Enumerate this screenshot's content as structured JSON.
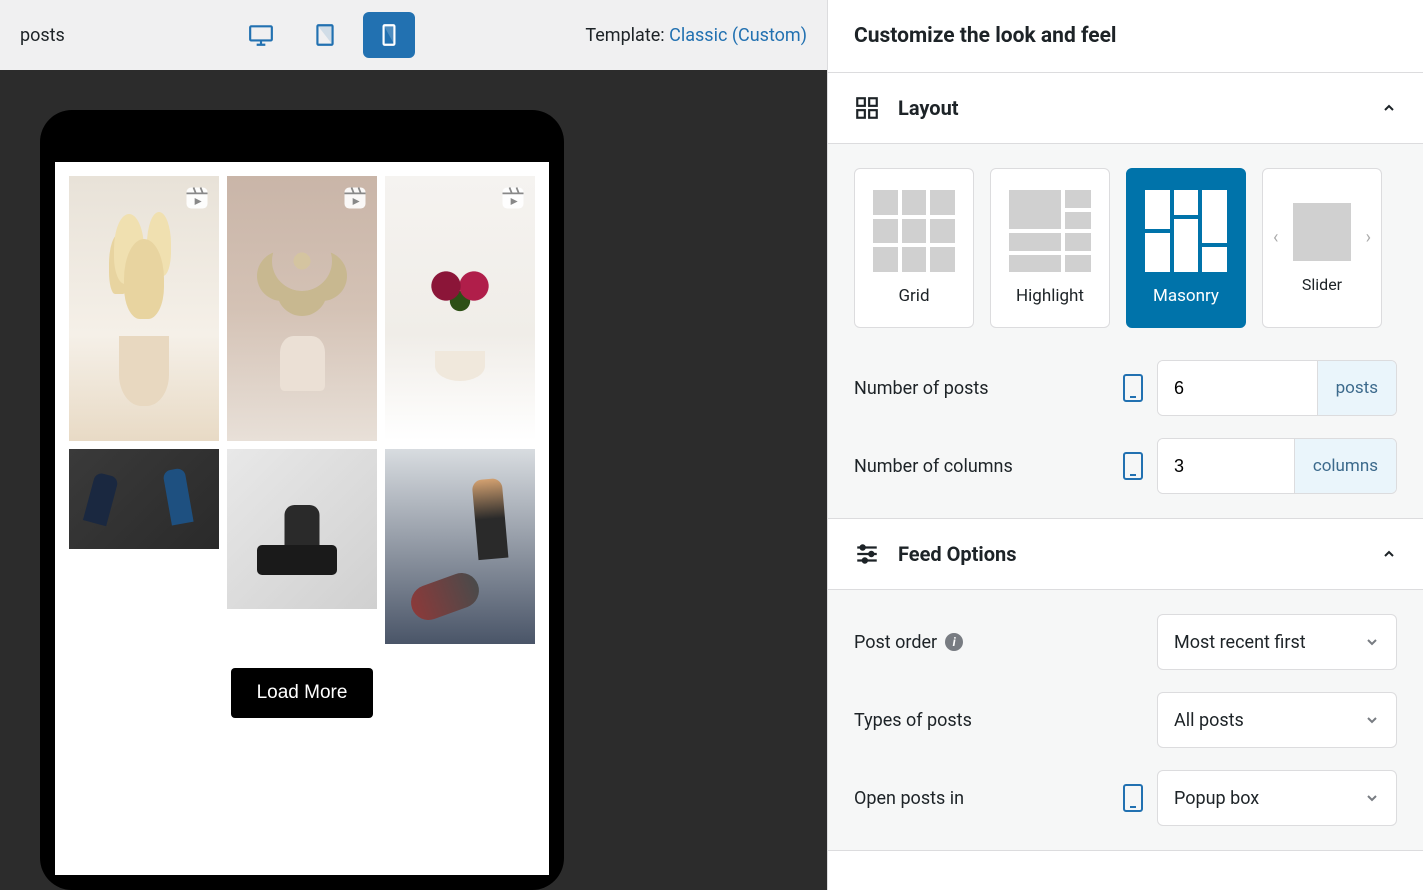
{
  "topbar": {
    "left_text": "posts",
    "devices": [
      "desktop",
      "tablet",
      "mobile"
    ],
    "active_device": "mobile",
    "template_label": "Template:",
    "template_value": "Classic (Custom)"
  },
  "preview": {
    "load_more_label": "Load More",
    "posts": [
      {
        "id": "plant1",
        "is_reel": true
      },
      {
        "id": "plant2",
        "is_reel": true
      },
      {
        "id": "plant3",
        "is_reel": true
      },
      {
        "id": "gym1",
        "is_reel": false
      },
      {
        "id": "gym2",
        "is_reel": false
      },
      {
        "id": "gym3",
        "is_reel": false
      }
    ]
  },
  "sidebar": {
    "title": "Customize the look and feel",
    "layout": {
      "heading": "Layout",
      "options": {
        "grid": "Grid",
        "highlight": "Highlight",
        "masonry": "Masonry",
        "slider": "Slider"
      },
      "active": "masonry",
      "num_posts": {
        "label": "Number of posts",
        "value": "6",
        "suffix": "posts"
      },
      "num_columns": {
        "label": "Number of columns",
        "value": "3",
        "suffix": "columns"
      }
    },
    "feed_options": {
      "heading": "Feed Options",
      "post_order": {
        "label": "Post order",
        "value": "Most recent first"
      },
      "types": {
        "label": "Types of posts",
        "value": "All posts"
      },
      "open_in": {
        "label": "Open posts in",
        "value": "Popup box"
      }
    }
  }
}
